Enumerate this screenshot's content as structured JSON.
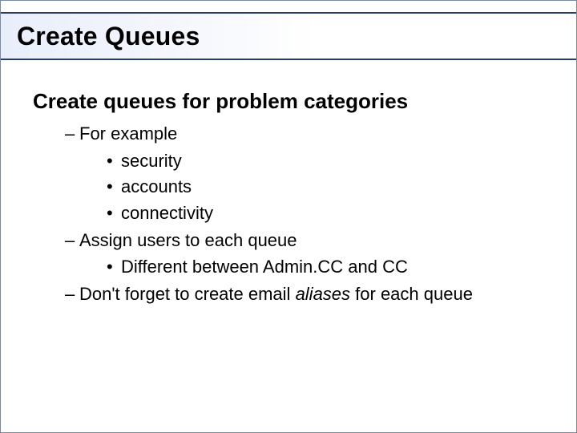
{
  "title": "Create Queues",
  "heading": "Create queues for problem categories",
  "items": {
    "forExample": "For example",
    "security": "security",
    "accounts": "accounts",
    "connectivity": "connectivity",
    "assignUsers": "Assign users to each queue",
    "diffAdminCC": "Different between Admin.CC and CC",
    "dontForget_pre": "Don't forget to create email ",
    "dontForget_italic": "aliases ",
    "dontForget_post": "for each queue"
  }
}
